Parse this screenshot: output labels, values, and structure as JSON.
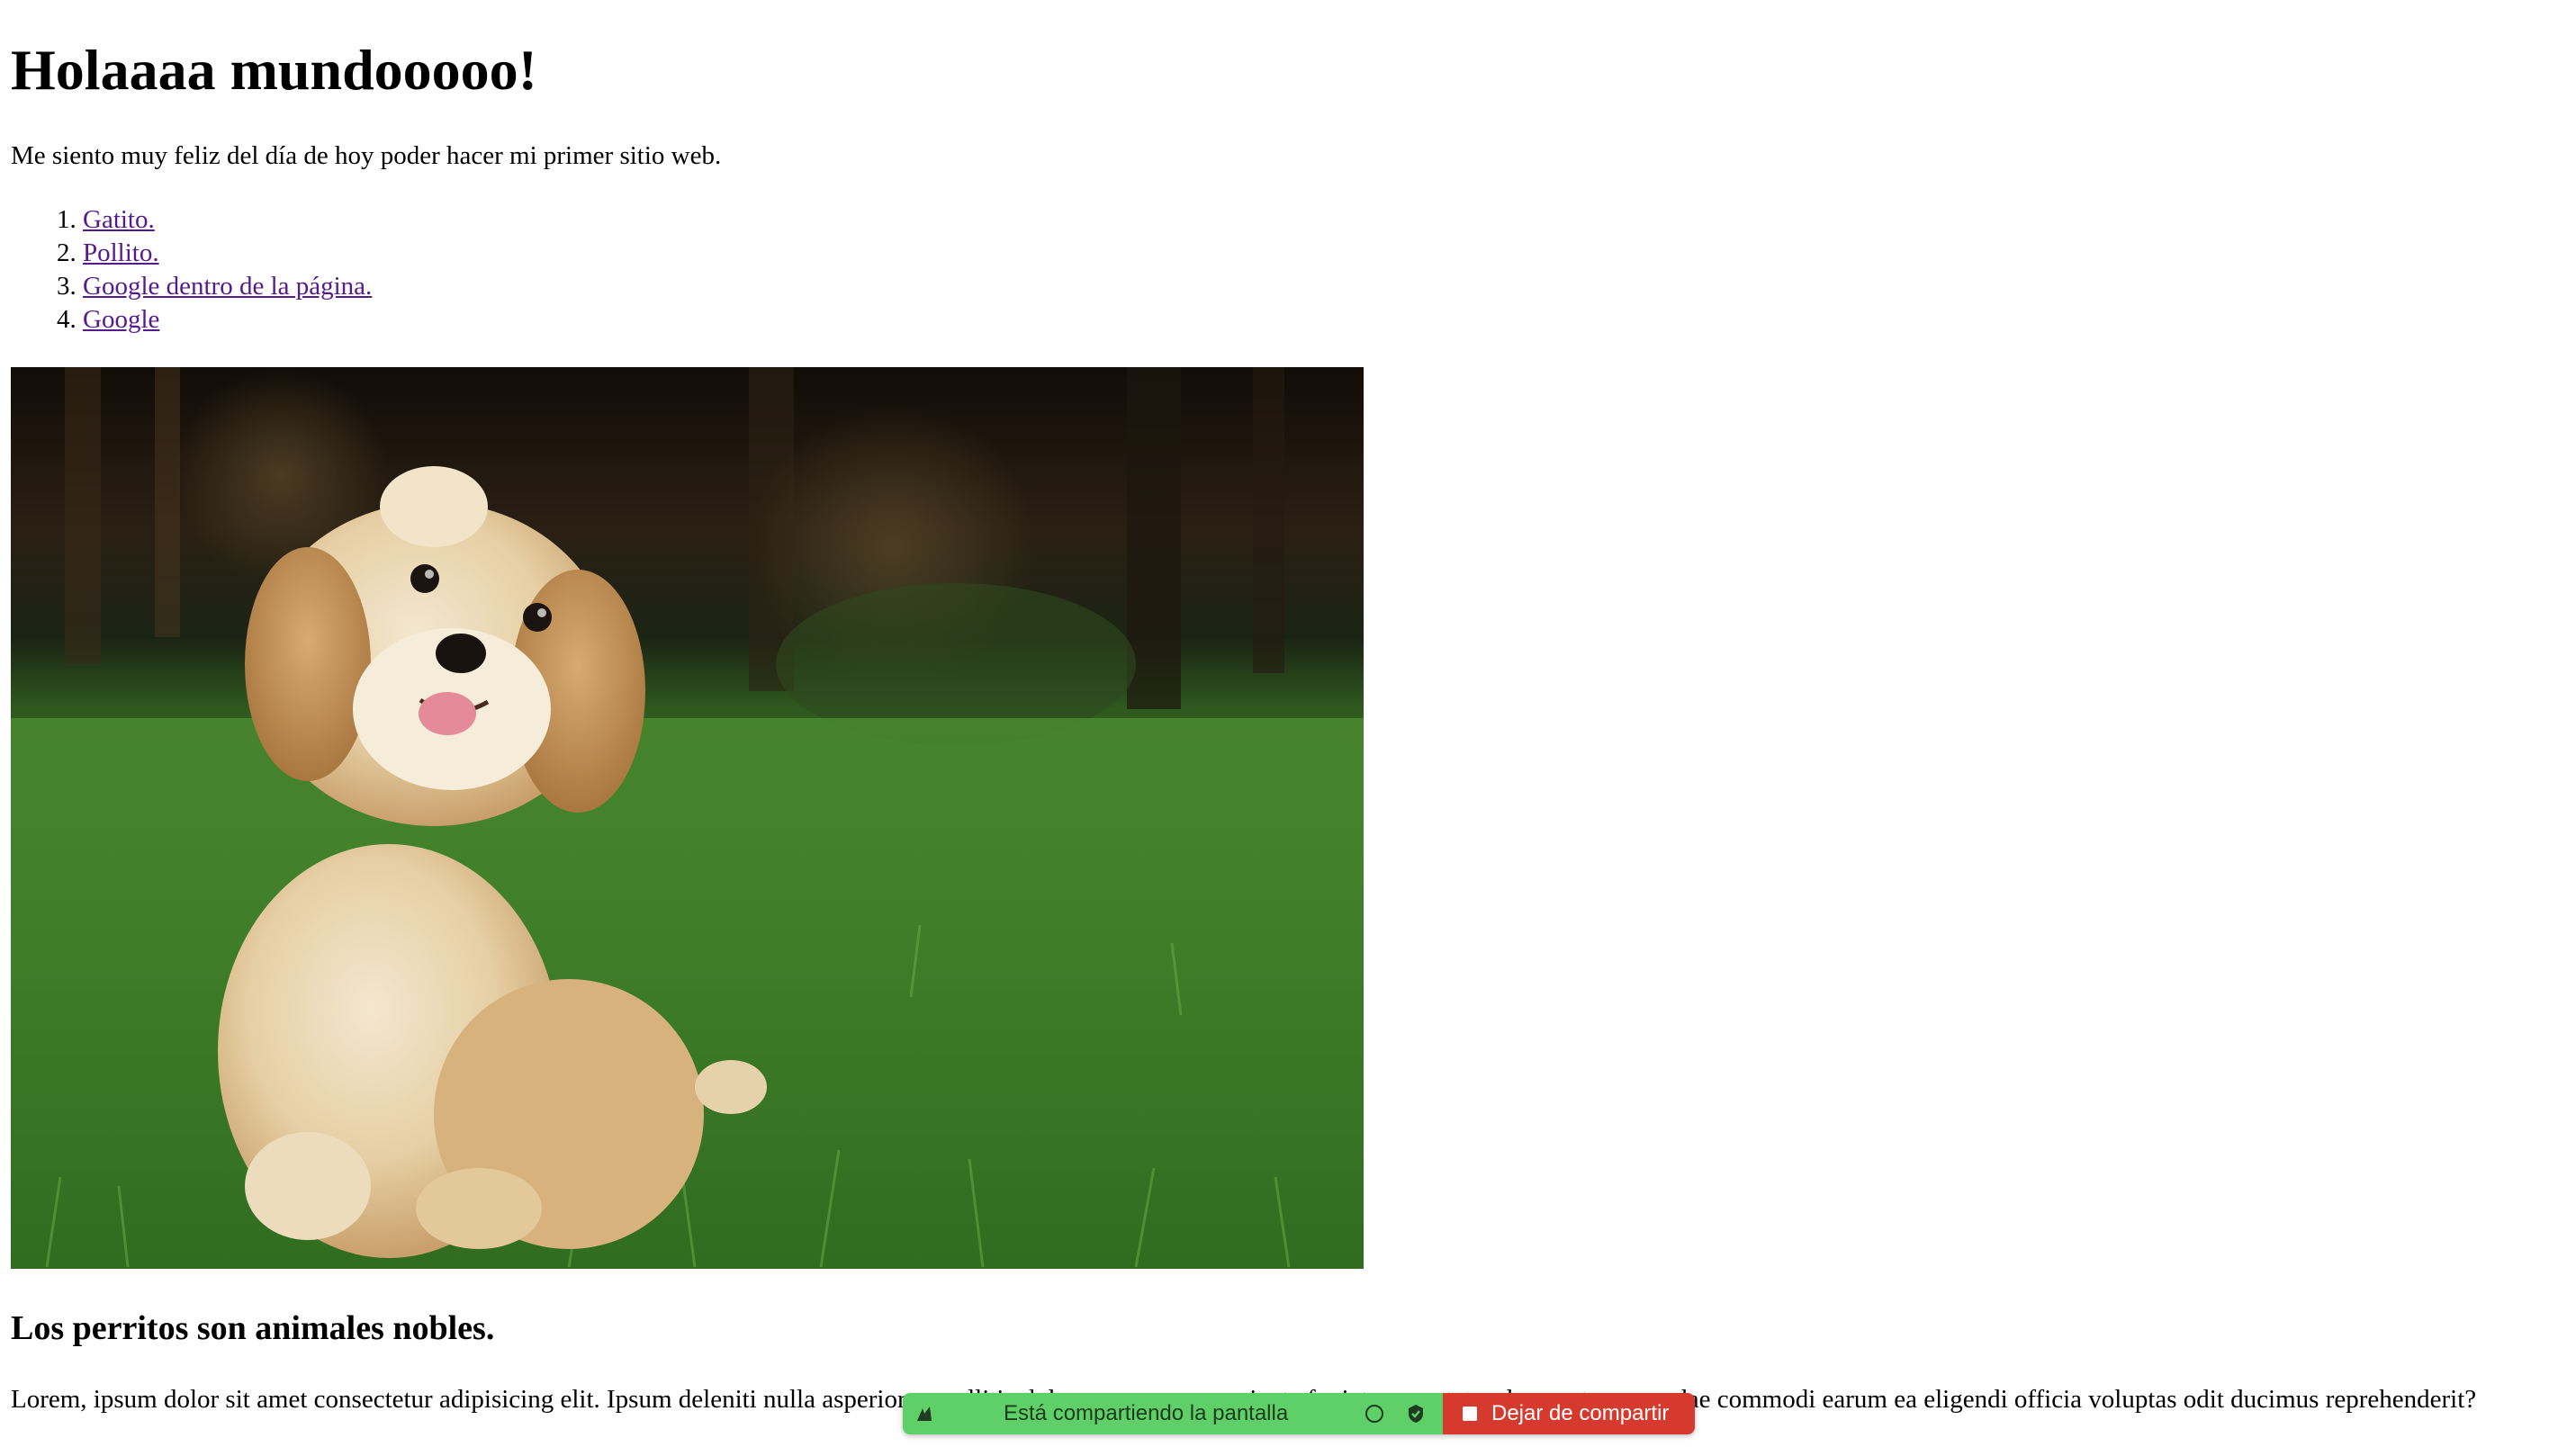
{
  "page": {
    "title": "Holaaaa mundooooo!",
    "intro": "Me siento muy feliz del día de hoy poder hacer mi primer sitio web.",
    "links": [
      {
        "label": "Gatito."
      },
      {
        "label": "Pollito."
      },
      {
        "label": "Google dentro de la página."
      },
      {
        "label": "Google"
      }
    ],
    "image": {
      "icon": "puppy-photo"
    },
    "section_heading": "Los perritos son animales nobles.",
    "lorem": "Lorem, ipsum dolor sit amet consectetur adipisicing elit. Ipsum deleniti nulla asperiores mollitia dolor quos, rerum sapiente fugiat consectetur deserunt recusandae commodi earum ea eligendi officia voluptas odit ducimus reprehenderit?"
  },
  "share_bar": {
    "status_text": "Está compartiendo la pantalla",
    "stop_label": "Dejar de compartir",
    "colors": {
      "bar": "#5fd068",
      "stop": "#d63a2f"
    }
  },
  "colors": {
    "visited_link": "#551a8b"
  }
}
